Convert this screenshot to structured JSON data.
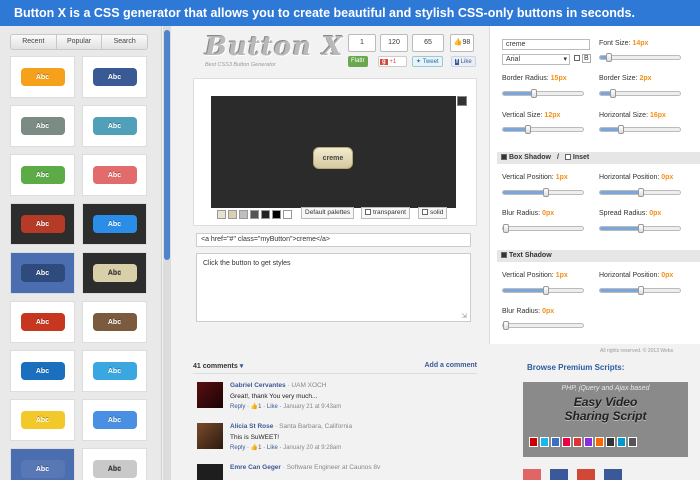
{
  "banner": "Button X is a CSS generator that allows you to create beautiful and stylish CSS-only buttons in seconds.",
  "sidebar": {
    "tabs": [
      "Recent",
      "Popular",
      "Search"
    ],
    "buttons": [
      {
        "label": "Abc",
        "bg": "#f5a11c"
      },
      {
        "label": "Abc",
        "bg": "#3a5a96"
      },
      {
        "label": "Abc",
        "bg": "#7a8c84"
      },
      {
        "label": "Abc",
        "bg": "#4fa0b8"
      },
      {
        "label": "Abc",
        "bg": "#5dab47"
      },
      {
        "label": "Abc",
        "bg": "#e26c6c"
      },
      {
        "label": "Abc",
        "bg": "#b53b27"
      },
      {
        "label": "Abc",
        "bg": "#2a8de8"
      },
      {
        "label": "Abc",
        "bg": "#2f4a7c"
      },
      {
        "label": "Abc",
        "bg": "#d9cfa8"
      },
      {
        "label": "Abc",
        "bg": "#c7371f"
      },
      {
        "label": "Abc",
        "bg": "#7b5a3e"
      },
      {
        "label": "Abc",
        "bg": "#1a6fbf"
      },
      {
        "label": "Abc",
        "bg": "#3aa7e0"
      },
      {
        "label": "Abc",
        "bg": "#f3c82b"
      },
      {
        "label": "Abc",
        "bg": "#4a90e2"
      },
      {
        "label": "Abc",
        "bg": "#5777b5"
      },
      {
        "label": "Abc",
        "bg": "#c9c9c9"
      }
    ]
  },
  "logo": {
    "title": "Button X",
    "subtitle": "Best CSS3 Button Generator"
  },
  "counters": {
    "c1": "1",
    "c2": "120",
    "c3": "65",
    "likes": "98"
  },
  "social": {
    "flattr": "Flattr",
    "gplus": "+1",
    "tweet": "Tweet",
    "like": "Like"
  },
  "preview": {
    "button_text": "creme",
    "palette_colors": [
      "#e6e0cf",
      "#d9cfb5",
      "#bfbfbf",
      "#555555",
      "#222222",
      "#000000",
      "#ffffff"
    ],
    "default_palettes": "Default palettes",
    "transparent": "transparent",
    "solid": "solid"
  },
  "code": "<a href=\"#\" class=\"myButton\">creme</a>",
  "styles_hint": "Click the button to get styles",
  "controls": {
    "text_value": "creme",
    "font_value": "Arial",
    "bold_label": "B",
    "font_size_label": "Font Size:",
    "font_size_value": "14px",
    "border_radius_label": "Border Radius:",
    "border_radius_value": "15px",
    "border_size_label": "Border Size:",
    "border_size_value": "2px",
    "vertical_size_label": "Vertical Size:",
    "vertical_size_value": "12px",
    "horizontal_size_label": "Horizontal Size:",
    "horizontal_size_value": "16px",
    "box_shadow_label": "Box Shadow",
    "separator": "/",
    "inset_label": "Inset",
    "bs_vpos_label": "Vertical Position:",
    "bs_vpos_value": "1px",
    "bs_hpos_label": "Horizontal Position:",
    "bs_hpos_value": "0px",
    "bs_blur_label": "Blur Radius:",
    "bs_blur_value": "0px",
    "bs_spread_label": "Spread Radius:",
    "bs_spread_value": "0px",
    "text_shadow_label": "Text Shadow",
    "ts_vpos_label": "Vertical Position:",
    "ts_vpos_value": "1px",
    "ts_hpos_label": "Horizontal Position:",
    "ts_hpos_value": "0px",
    "ts_blur_label": "Blur Radius:",
    "ts_blur_value": "0px"
  },
  "copyright": "All rights reserved. © 2013 Webs",
  "comments": {
    "count_label": "41 comments",
    "add_label": "Add a comment",
    "items": [
      {
        "name": "Gabriel Cervantes",
        "meta": " · UAM XOCH",
        "text": "Great!, thank You very much...",
        "reply": "Reply",
        "likes": "1",
        "like": "Like",
        "date": "January 21 at 9:43am"
      },
      {
        "name": "Alicia St Rose",
        "meta": " · Santa Barbara, California",
        "text": "This is SuWEET!",
        "reply": "Reply",
        "likes": "1",
        "like": "Like",
        "date": "January 20 at 9:28am"
      },
      {
        "name": "Emre Can Geger",
        "meta": " · Software Engineer at Caunos 8v",
        "text": "",
        "reply": "",
        "likes": "",
        "like": "",
        "date": ""
      }
    ]
  },
  "premium": {
    "title": "Browse Premium Scripts:",
    "sub": "PHP, jQuery and Ajax based",
    "main1": "Easy Video",
    "main2": "Sharing Script"
  }
}
